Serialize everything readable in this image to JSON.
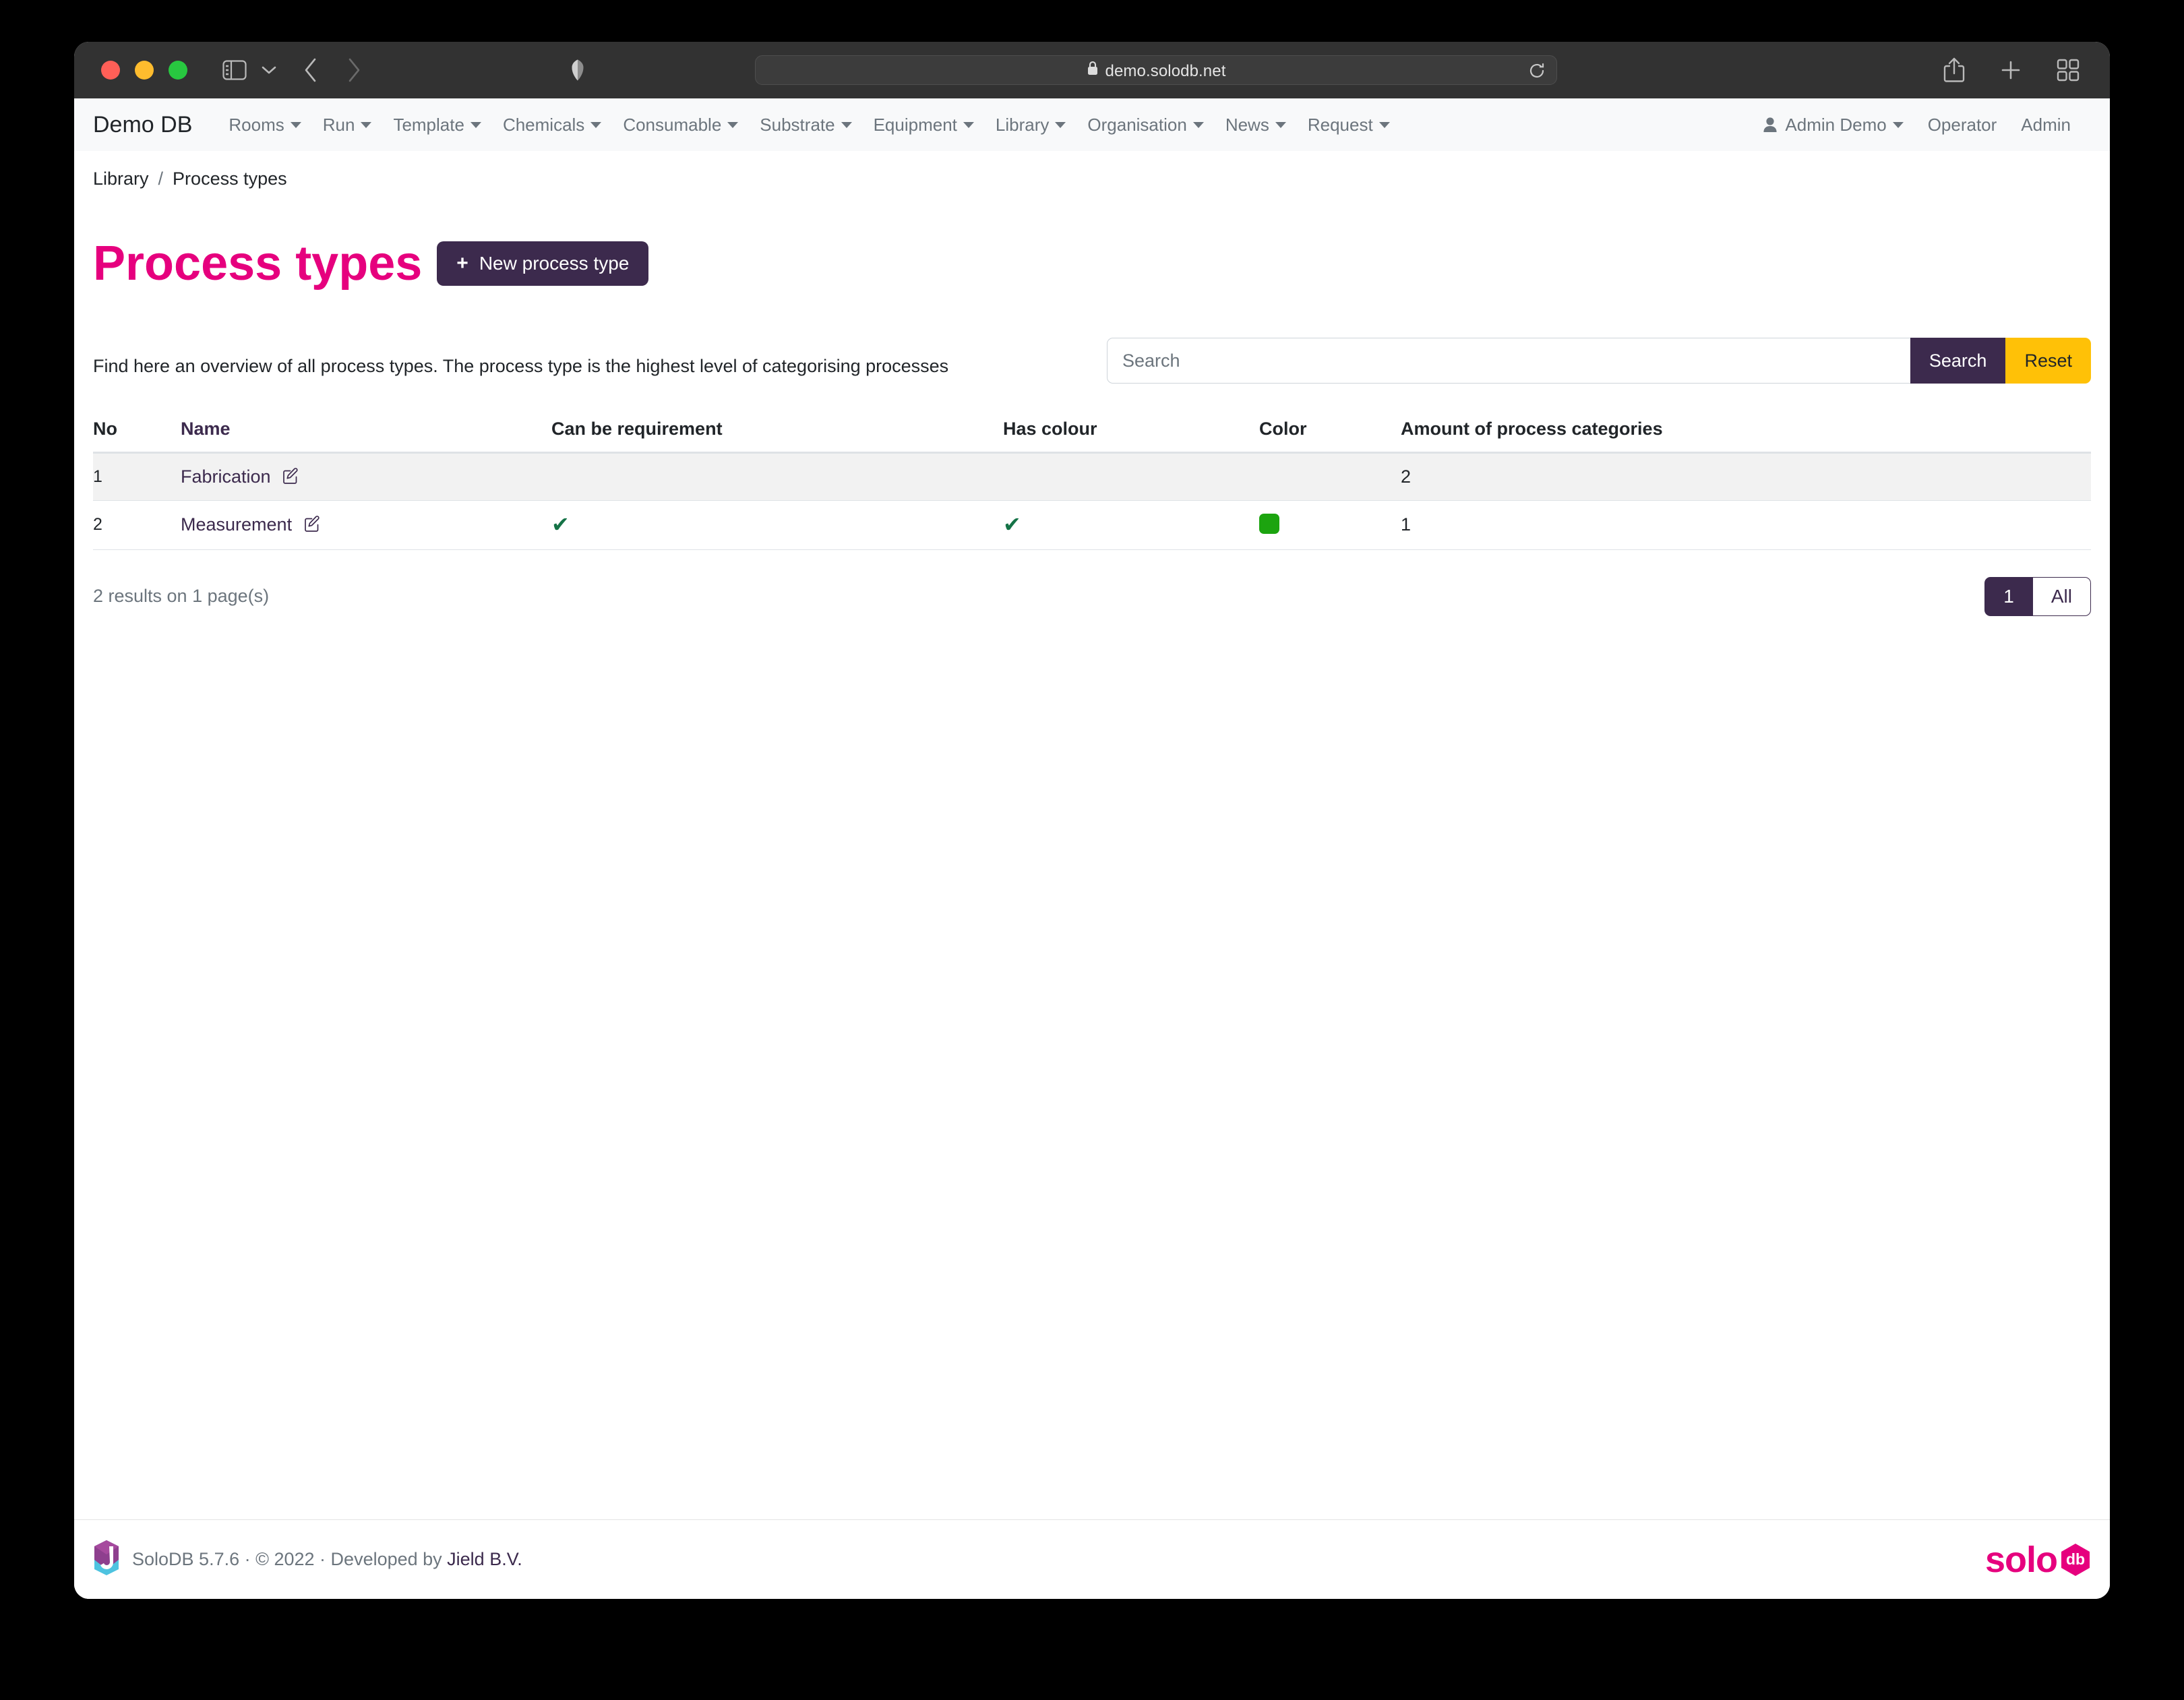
{
  "browser": {
    "url": "demo.solodb.net",
    "lock_icon": "lock-icon",
    "reload_icon": "reload-icon",
    "share_icon": "share-icon",
    "new_tab_icon": "plus-icon",
    "tab_overview_icon": "tab-overview-icon",
    "sidebar_icon": "sidebar-toggle-icon",
    "back_icon": "chevron-left-icon",
    "forward_icon": "chevron-right-icon",
    "shield_icon": "privacy-shield-icon"
  },
  "navbar": {
    "brand": "Demo DB",
    "items": [
      {
        "label": "Rooms",
        "has_caret": true
      },
      {
        "label": "Run",
        "has_caret": true
      },
      {
        "label": "Template",
        "has_caret": true
      },
      {
        "label": "Chemicals",
        "has_caret": true
      },
      {
        "label": "Consumable",
        "has_caret": true
      },
      {
        "label": "Substrate",
        "has_caret": true
      },
      {
        "label": "Equipment",
        "has_caret": true
      },
      {
        "label": "Library",
        "has_caret": true
      },
      {
        "label": "Organisation",
        "has_caret": true
      },
      {
        "label": "News",
        "has_caret": true
      },
      {
        "label": "Request",
        "has_caret": true
      }
    ],
    "right": {
      "user_icon": "user-icon",
      "user_label": "Admin Demo",
      "operator_label": "Operator",
      "admin_label": "Admin"
    }
  },
  "breadcrumb": {
    "parent": "Library",
    "separator": "/",
    "current": "Process types"
  },
  "header": {
    "title": "Process types",
    "new_button_label": "New process type",
    "new_button_icon": "plus-icon",
    "description": "Find here an overview of all process types. The process type is the highest level of categorising processes"
  },
  "search": {
    "placeholder": "Search",
    "value": "",
    "search_label": "Search",
    "reset_label": "Reset"
  },
  "table": {
    "columns": [
      "No",
      "Name",
      "Can be requirement",
      "Has colour",
      "Color",
      "Amount of process categories"
    ],
    "rows": [
      {
        "no": "1",
        "name": "Fabrication",
        "edit_icon": "edit-icon",
        "can_be_requirement": false,
        "has_colour": false,
        "color": "",
        "amount": "2"
      },
      {
        "no": "2",
        "name": "Measurement",
        "edit_icon": "edit-icon",
        "can_be_requirement": true,
        "has_colour": true,
        "color": "#1ca40f",
        "amount": "1"
      }
    ],
    "check_glyph": "✔"
  },
  "list_footer": {
    "results_text": "2 results on 1 page(s)",
    "pagination": [
      {
        "label": "1",
        "active": true
      },
      {
        "label": "All",
        "active": false
      }
    ]
  },
  "footer": {
    "logo_icon": "jield-j-logo",
    "text_prefix": "SoloDB 5.7.6 · © 2022 · Developed by ",
    "developer": "Jield B.V.",
    "brand_logo_text": "solo",
    "brand_logo_badge": "db"
  },
  "colors": {
    "accent_pink": "#e6007e",
    "accent_purple": "#3c2a4d",
    "accent_amber": "#ffc107",
    "check_green": "#157347"
  }
}
